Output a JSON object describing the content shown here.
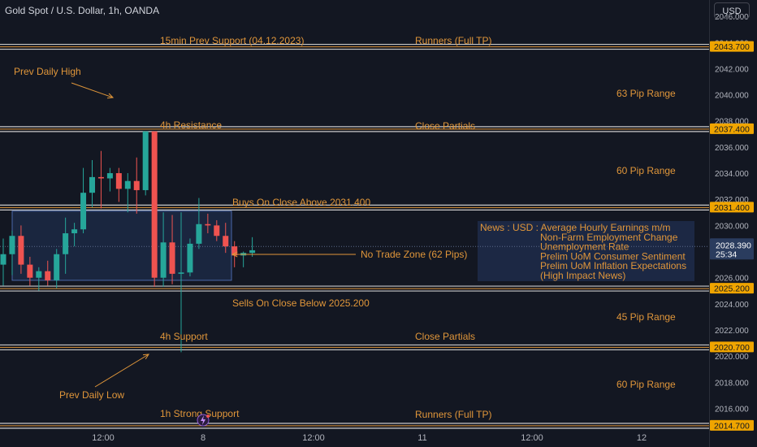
{
  "header": {
    "symbol": "Gold Spot / U.S. Dollar, 1h, OANDA",
    "currency": "USD"
  },
  "colors": {
    "background": "#131722",
    "bull": "#26a69a",
    "bear": "#ef5350",
    "annotation": "#e0963a",
    "level_line": "#c9c9c9",
    "zone_fill": "#1e2c4a",
    "zone_border": "#4a67a8",
    "price_label_bg": "#f0a500",
    "current_price_bg": "#2a3c5e"
  },
  "chart_data": {
    "type": "candlestick",
    "ylim": [
      2013.4,
      2046.0
    ],
    "y_ticks": [
      2016,
      2018,
      2020,
      2022,
      2024,
      2026,
      2028,
      2030,
      2032,
      2034,
      2036,
      2038,
      2040,
      2042,
      2044,
      2046
    ],
    "y_tick_labels": [
      "2016.000",
      "2018.000",
      "2020.000",
      "2022.000",
      "2024.000",
      "2026.000",
      "2028.000",
      "2030.000",
      "2032.000",
      "2034.000",
      "2036.000",
      "2038.000",
      "2040.000",
      "2042.000",
      "2044.000",
      "2046.000"
    ],
    "x_labels": [
      "12:00",
      "8",
      "12:00",
      "11",
      "12:00",
      "12"
    ],
    "candles": [
      {
        "o": 2027.0,
        "h": 2029.0,
        "l": 2025.4,
        "c": 2027.8
      },
      {
        "o": 2027.8,
        "h": 2029.6,
        "l": 2026.2,
        "c": 2029.2
      },
      {
        "o": 2029.2,
        "h": 2030.0,
        "l": 2026.3,
        "c": 2027.0
      },
      {
        "o": 2027.0,
        "h": 2027.6,
        "l": 2025.4,
        "c": 2026.0
      },
      {
        "o": 2026.0,
        "h": 2026.8,
        "l": 2025.0,
        "c": 2026.5
      },
      {
        "o": 2026.5,
        "h": 2027.3,
        "l": 2025.4,
        "c": 2025.8
      },
      {
        "o": 2025.8,
        "h": 2028.2,
        "l": 2025.2,
        "c": 2027.8
      },
      {
        "o": 2027.8,
        "h": 2030.6,
        "l": 2026.3,
        "c": 2029.4
      },
      {
        "o": 2029.4,
        "h": 2030.2,
        "l": 2028.4,
        "c": 2029.7
      },
      {
        "o": 2029.7,
        "h": 2034.4,
        "l": 2029.4,
        "c": 2032.5
      },
      {
        "o": 2032.5,
        "h": 2035.0,
        "l": 2031.4,
        "c": 2033.7
      },
      {
        "o": 2033.7,
        "h": 2035.7,
        "l": 2031.3,
        "c": 2033.6
      },
      {
        "o": 2033.6,
        "h": 2034.4,
        "l": 2032.6,
        "c": 2034.0
      },
      {
        "o": 2034.0,
        "h": 2034.4,
        "l": 2031.8,
        "c": 2032.8
      },
      {
        "o": 2032.8,
        "h": 2034.0,
        "l": 2031.0,
        "c": 2033.4
      },
      {
        "o": 2033.4,
        "h": 2035.2,
        "l": 2030.9,
        "c": 2032.7
      },
      {
        "o": 2032.7,
        "h": 2037.2,
        "l": 2032.3,
        "c": 2037.2
      },
      {
        "o": 2037.2,
        "h": 2037.2,
        "l": 2025.3,
        "c": 2026.0
      },
      {
        "o": 2026.0,
        "h": 2031.0,
        "l": 2025.3,
        "c": 2028.7
      },
      {
        "o": 2028.7,
        "h": 2030.8,
        "l": 2025.5,
        "c": 2026.3
      },
      {
        "o": 2026.3,
        "h": 2031.0,
        "l": 2020.3,
        "c": 2026.4
      },
      {
        "o": 2026.4,
        "h": 2029.0,
        "l": 2026.1,
        "c": 2028.6
      },
      {
        "o": 2028.6,
        "h": 2032.1,
        "l": 2028.2,
        "c": 2030.1
      },
      {
        "o": 2030.1,
        "h": 2030.9,
        "l": 2029.4,
        "c": 2030.0
      },
      {
        "o": 2030.0,
        "h": 2030.4,
        "l": 2028.8,
        "c": 2029.2
      },
      {
        "o": 2029.2,
        "h": 2030.2,
        "l": 2027.9,
        "c": 2028.4
      },
      {
        "o": 2028.4,
        "h": 2028.8,
        "l": 2026.8,
        "c": 2027.7
      },
      {
        "o": 2027.7,
        "h": 2028.0,
        "l": 2026.8,
        "c": 2027.9
      },
      {
        "o": 2027.9,
        "h": 2029.1,
        "l": 2027.6,
        "c": 2028.1
      }
    ],
    "levels": [
      2043.7,
      2037.4,
      2031.4,
      2025.2,
      2020.7,
      2014.7
    ],
    "level_labels": [
      "2043.700",
      "2037.400",
      "2031.400",
      "2025.200",
      "2020.700",
      "2014.700"
    ],
    "current_price": 2028.39,
    "current_price_label": "2028.390",
    "countdown": "25:34",
    "no_trade_zone": {
      "from": 2025.8,
      "to": 2031.1
    }
  },
  "annotations": {
    "support_15min": "15min Prev Support (04.12.2023)",
    "runners_top": "Runners (Full TP)",
    "prev_daily_high": "Prev Daily High",
    "pip_range_63": "63 Pip Range",
    "resistance_4h": "4h Resistance",
    "close_partials_top": "Close Partials",
    "pip_range_60_top": "60 Pip Range",
    "buys_on_close": "Buys On Close Above 2031.400",
    "no_trade_zone": "No Trade Zone (62 Pips)",
    "sells_on_close": "Sells On Close Below 2025.200",
    "pip_range_45": "45 Pip Range",
    "support_4h": "4h Support",
    "close_partials_bottom": "Close Partials",
    "prev_daily_low": "Prev Daily Low",
    "pip_range_60_bottom": "60 Pip Range",
    "strong_support_1h": "1h Strong Support",
    "runners_bottom": "Runners (Full TP)"
  },
  "news": {
    "prefix": "News : USD : ",
    "lines": [
      "Average Hourly Earnings m/m",
      "Non-Farm Employment Change",
      "Unemployment Rate",
      "Prelim UoM Consumer Sentiment",
      "Prelim UoM Inflation Expectations",
      "(High Impact News)"
    ]
  }
}
